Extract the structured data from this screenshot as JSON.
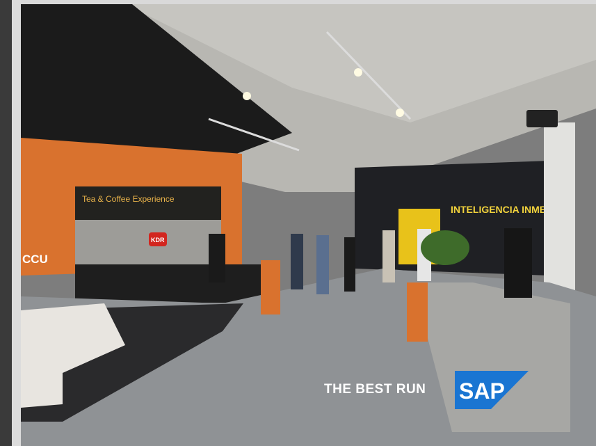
{
  "photo": {
    "tagline": "THE BEST RUN",
    "brand_logo": "SAP",
    "wall_signs": {
      "counter_panel": "Tea & Coffee Experience",
      "lower_logo": "CCU",
      "screen_headline": "INTELIGENCIA INMERSIVA",
      "red_badge": "KDR"
    }
  },
  "colors": {
    "orange_wall": "#d9722e",
    "sap_blue": "#1a75d2",
    "ceiling": "#b9b9b5",
    "floor": "#8f9295",
    "yellow_accent": "#e8c21a"
  }
}
